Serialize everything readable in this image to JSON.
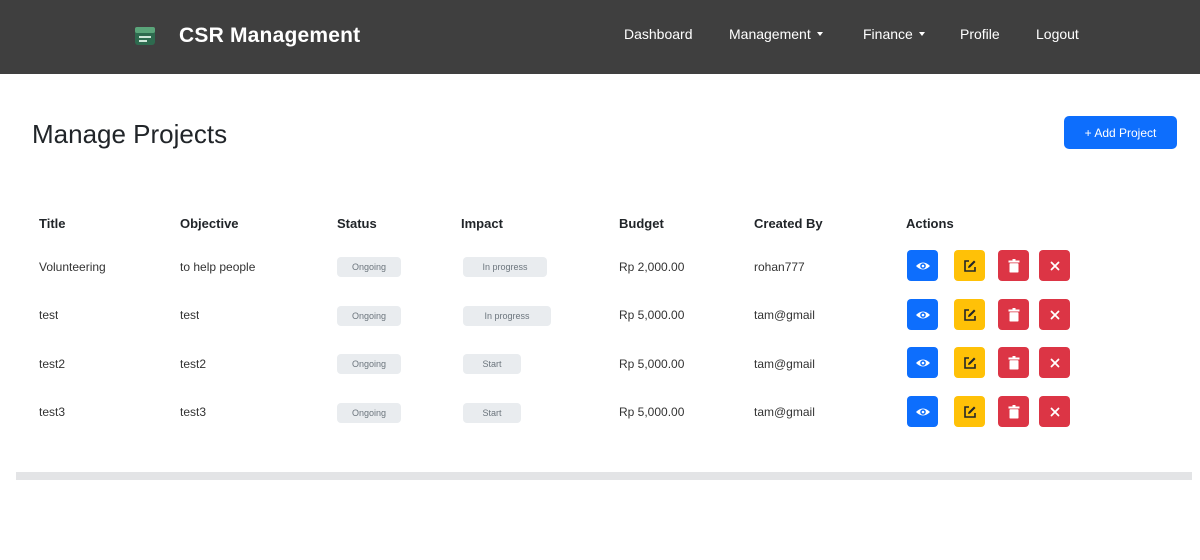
{
  "navbar": {
    "brand": "CSR Management",
    "items": [
      {
        "label": "Dashboard"
      },
      {
        "label": "Management",
        "dropdown": true
      },
      {
        "label": "Finance",
        "dropdown": true
      },
      {
        "label": "Profile"
      },
      {
        "label": "Logout"
      }
    ],
    "colors": {
      "background": "#3f3f3f",
      "text": "#ffffff"
    }
  },
  "page": {
    "title": "Manage Projects",
    "add_button": "+ Add Project"
  },
  "table": {
    "headers": [
      "Title",
      "Objective",
      "Status",
      "Impact",
      "Budget",
      "Created By",
      "Actions"
    ],
    "rows": [
      {
        "title": "Volunteering",
        "objective": "to help people",
        "status": "Ongoing",
        "impact": "In progress",
        "budget": "Rp 2,000.00",
        "created_by": "rohan777"
      },
      {
        "title": "test",
        "objective": "test",
        "status": "Ongoing",
        "impact": "In progress",
        "budget": "Rp 5,000.00",
        "created_by": "tam@gmail"
      },
      {
        "title": "test2",
        "objective": "test2",
        "status": "Ongoing",
        "impact": "Start",
        "budget": "Rp 5,000.00",
        "created_by": "tam@gmail"
      },
      {
        "title": "test3",
        "objective": "test3",
        "status": "Ongoing",
        "impact": "Start",
        "budget": "Rp 5,000.00",
        "created_by": "tam@gmail"
      }
    ],
    "actions": [
      {
        "name": "view",
        "icon": "eye-icon",
        "color": "#0d6efd"
      },
      {
        "name": "edit",
        "icon": "pencil-square-icon",
        "color": "#ffc107"
      },
      {
        "name": "delete",
        "icon": "trash-icon",
        "color": "#dc3545"
      },
      {
        "name": "cancel",
        "icon": "close-icon",
        "color": "#dc3545"
      }
    ]
  }
}
